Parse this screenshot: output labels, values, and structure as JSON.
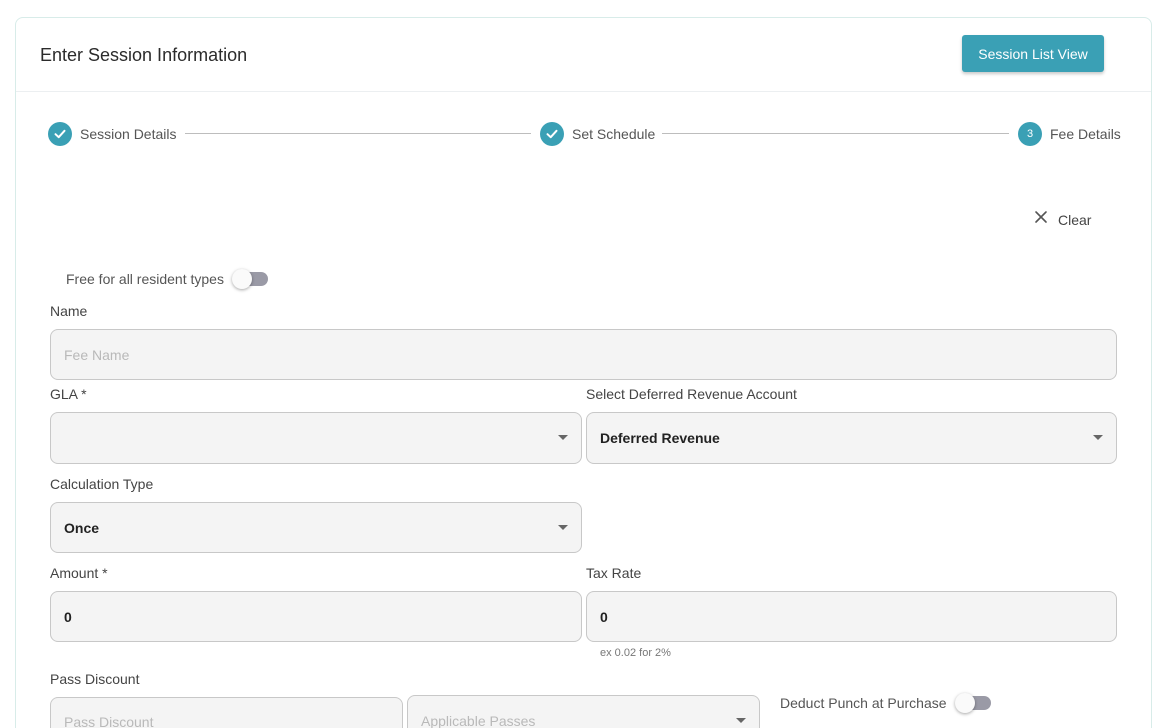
{
  "header": {
    "title": "Enter Session Information",
    "list_button": "Session List View"
  },
  "stepper": {
    "steps": [
      {
        "label": "Session Details",
        "state": "complete",
        "icon": "check-icon"
      },
      {
        "label": "Set Schedule",
        "state": "complete",
        "icon": "check-icon"
      },
      {
        "label": "Fee Details",
        "state": "active",
        "number": "3"
      }
    ]
  },
  "actions": {
    "clear_label": "Clear"
  },
  "form": {
    "free_toggle": {
      "label": "Free for all resident types",
      "on": false
    },
    "name": {
      "label": "Name",
      "placeholder": "Fee Name",
      "value": ""
    },
    "gla": {
      "label": "GLA *",
      "value": ""
    },
    "deferred": {
      "label": "Select Deferred Revenue Account",
      "value": "Deferred Revenue"
    },
    "calc_type": {
      "label": "Calculation Type",
      "value": "Once"
    },
    "amount": {
      "label": "Amount *",
      "value": "0"
    },
    "tax_rate": {
      "label": "Tax Rate",
      "value": "0",
      "hint": "ex 0.02 for 2%"
    },
    "pass_discount": {
      "label": "Pass Discount",
      "placeholder": "Pass Discount",
      "passes_placeholder": "Applicable Passes"
    },
    "deduct_punch": {
      "label": "Deduct Punch at Purchase",
      "on": false
    }
  },
  "colors": {
    "accent": "#3aa0b5",
    "field_bg": "#f4f4f4",
    "toggle_track": "#9a9aa6"
  }
}
